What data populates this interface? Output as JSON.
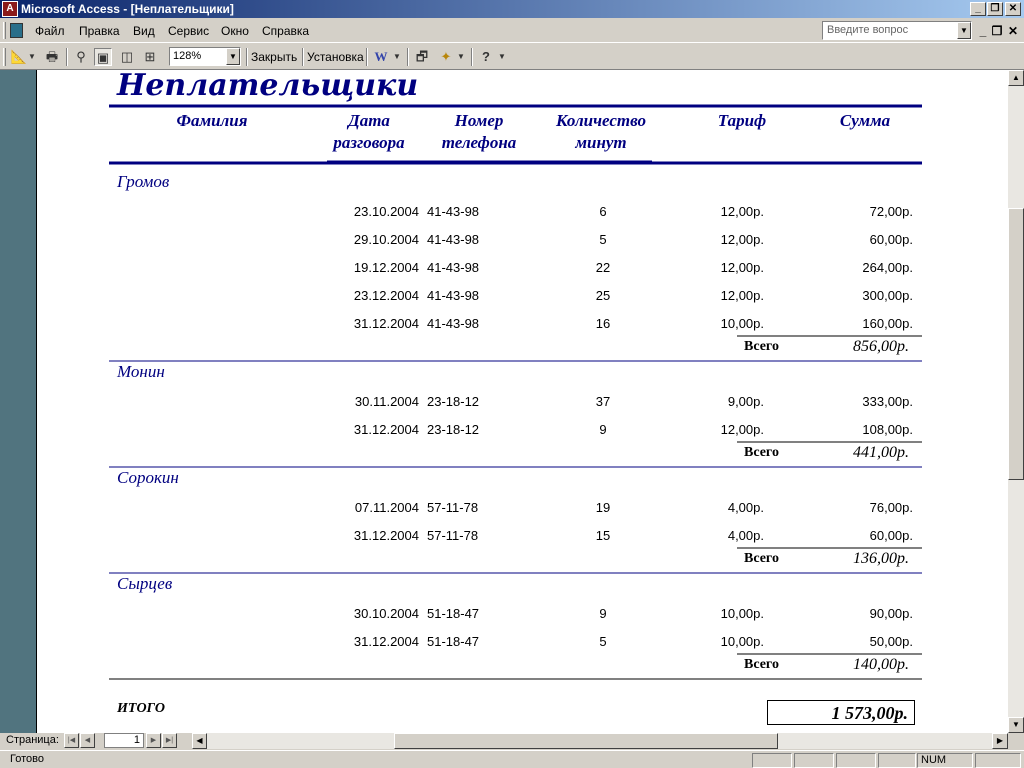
{
  "window": {
    "title": "Microsoft Access - [Неплательщики]",
    "help_placeholder": "Введите вопрос"
  },
  "menu": [
    "Файл",
    "Правка",
    "Вид",
    "Сервис",
    "Окно",
    "Справка"
  ],
  "toolbar": {
    "zoom": "128%",
    "close_label": "Закрыть",
    "setup_label": "Установка"
  },
  "report": {
    "title": "Неплательщики",
    "headers": {
      "surname": "Фамилия",
      "date1": "Дата",
      "date2": "разговора",
      "phone1": "Номер",
      "phone2": "телефона",
      "minutes1": "Количество",
      "minutes2": "минут",
      "tariff": "Тариф",
      "sum": "Сумма"
    },
    "total_label": "Всего",
    "groups": [
      {
        "name": "Громов",
        "total": "856,00р.",
        "rows": [
          {
            "date": "23.10.2004",
            "phone": "41-43-98",
            "minutes": "6",
            "tariff": "12,00р.",
            "sum": "72,00р."
          },
          {
            "date": "29.10.2004",
            "phone": "41-43-98",
            "minutes": "5",
            "tariff": "12,00р.",
            "sum": "60,00р."
          },
          {
            "date": "19.12.2004",
            "phone": "41-43-98",
            "minutes": "22",
            "tariff": "12,00р.",
            "sum": "264,00р."
          },
          {
            "date": "23.12.2004",
            "phone": "41-43-98",
            "minutes": "25",
            "tariff": "12,00р.",
            "sum": "300,00р."
          },
          {
            "date": "31.12.2004",
            "phone": "41-43-98",
            "minutes": "16",
            "tariff": "10,00р.",
            "sum": "160,00р."
          }
        ]
      },
      {
        "name": "Монин",
        "total": "441,00р.",
        "rows": [
          {
            "date": "30.11.2004",
            "phone": "23-18-12",
            "minutes": "37",
            "tariff": "9,00р.",
            "sum": "333,00р."
          },
          {
            "date": "31.12.2004",
            "phone": "23-18-12",
            "minutes": "9",
            "tariff": "12,00р.",
            "sum": "108,00р."
          }
        ]
      },
      {
        "name": "Сорокин",
        "total": "136,00р.",
        "rows": [
          {
            "date": "07.11.2004",
            "phone": "57-11-78",
            "minutes": "19",
            "tariff": "4,00р.",
            "sum": "76,00р."
          },
          {
            "date": "31.12.2004",
            "phone": "57-11-78",
            "minutes": "15",
            "tariff": "4,00р.",
            "sum": "60,00р."
          }
        ]
      },
      {
        "name": "Сырцев",
        "total": "140,00р.",
        "rows": [
          {
            "date": "30.10.2004",
            "phone": "51-18-47",
            "minutes": "9",
            "tariff": "10,00р.",
            "sum": "90,00р."
          },
          {
            "date": "31.12.2004",
            "phone": "51-18-47",
            "minutes": "5",
            "tariff": "10,00р.",
            "sum": "50,00р."
          }
        ]
      }
    ],
    "grand_label": "ИТОГО",
    "grand_total": "1 573,00р."
  },
  "nav": {
    "label": "Страница:",
    "page": "1"
  },
  "status": {
    "text": "Готово",
    "num": "NUM"
  }
}
